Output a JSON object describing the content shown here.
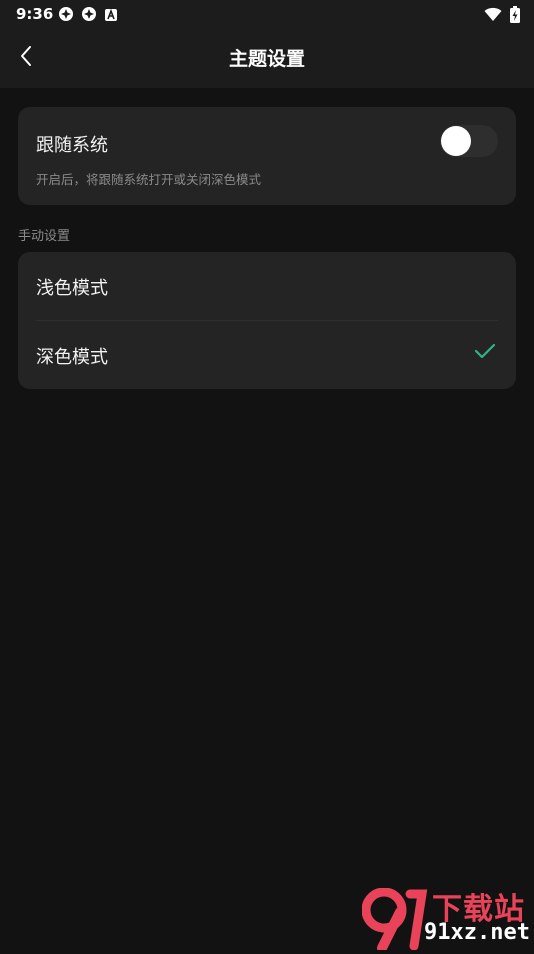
{
  "status_bar": {
    "time": "9:36",
    "left_icons": [
      "notification-icon",
      "notification-icon",
      "keyboard-icon"
    ],
    "right_icons": [
      "wifi-icon",
      "battery-charging-icon"
    ]
  },
  "header": {
    "title": "主题设置",
    "back_icon": "chevron-left-icon"
  },
  "follow_system": {
    "title": "跟随系统",
    "description": "开启后，将跟随系统打开或关闭深色模式",
    "enabled": false
  },
  "manual": {
    "section_label": "手动设置",
    "options": [
      {
        "label": "浅色模式",
        "selected": false
      },
      {
        "label": "深色模式",
        "selected": true
      }
    ]
  },
  "watermark": {
    "logo": "91",
    "title": "下载站",
    "url": "91xz.net"
  },
  "colors": {
    "background": "#121212",
    "card": "#242424",
    "check": "#2fb583",
    "watermark_red": "#e9435a"
  }
}
